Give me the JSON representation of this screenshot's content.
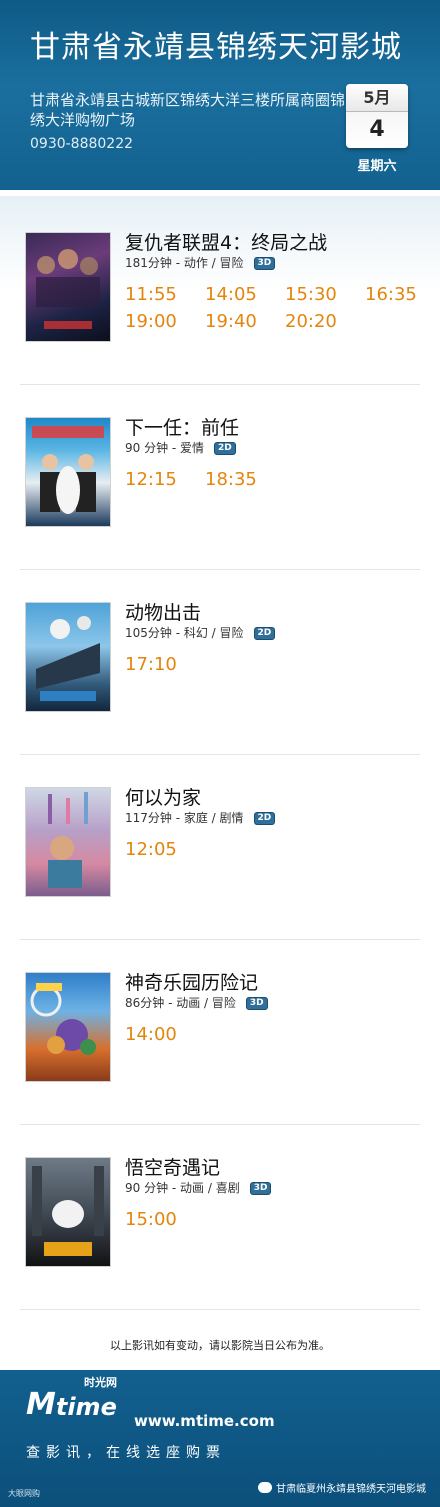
{
  "header": {
    "cinema_name": "甘肃省永靖县锦绣天河影城",
    "address": "甘肃省永靖县古城新区锦绣大洋三楼所属商圈锦绣大洋购物广场",
    "phone": "0930-8880222",
    "month": "5月",
    "day": "4",
    "weekday": "星期六"
  },
  "colors": {
    "header_bg": "#1a6f9e",
    "showtime": "#e2860e",
    "badge": "#2f6f99"
  },
  "movies": [
    {
      "title": "复仇者联盟4：终局之战",
      "meta": "181分钟 - 动作 / 冒险",
      "format": "3D",
      "times": [
        "11:55",
        "14:05",
        "15:30",
        "16:35",
        "19:00",
        "19:40",
        "20:20"
      ]
    },
    {
      "title": "下一任：前任",
      "meta": "90 分钟 - 爱情",
      "format": "2D",
      "times": [
        "12:15",
        "18:35"
      ]
    },
    {
      "title": "动物出击",
      "meta": "105分钟 - 科幻 / 冒险",
      "format": "2D",
      "times": [
        "17:10"
      ]
    },
    {
      "title": "何以为家",
      "meta": "117分钟 - 家庭 / 剧情",
      "format": "2D",
      "times": [
        "12:05"
      ]
    },
    {
      "title": "神奇乐园历险记",
      "meta": "86分钟 - 动画 / 冒险",
      "format": "3D",
      "times": [
        "14:00"
      ]
    },
    {
      "title": "悟空奇遇记",
      "meta": "90 分钟 - 动画 / 喜剧",
      "format": "3D",
      "times": [
        "15:00"
      ]
    }
  ],
  "notice": "以上影讯如有变动，请以影院当日公布为准。",
  "footer": {
    "brand_cn": "时光网",
    "url": "www.mtime.com",
    "slogan": "查影讯，在线选座购票",
    "small_brand": "大眼网购",
    "wechat_account": "甘肃临夏州永靖县锦绣天河电影城"
  }
}
